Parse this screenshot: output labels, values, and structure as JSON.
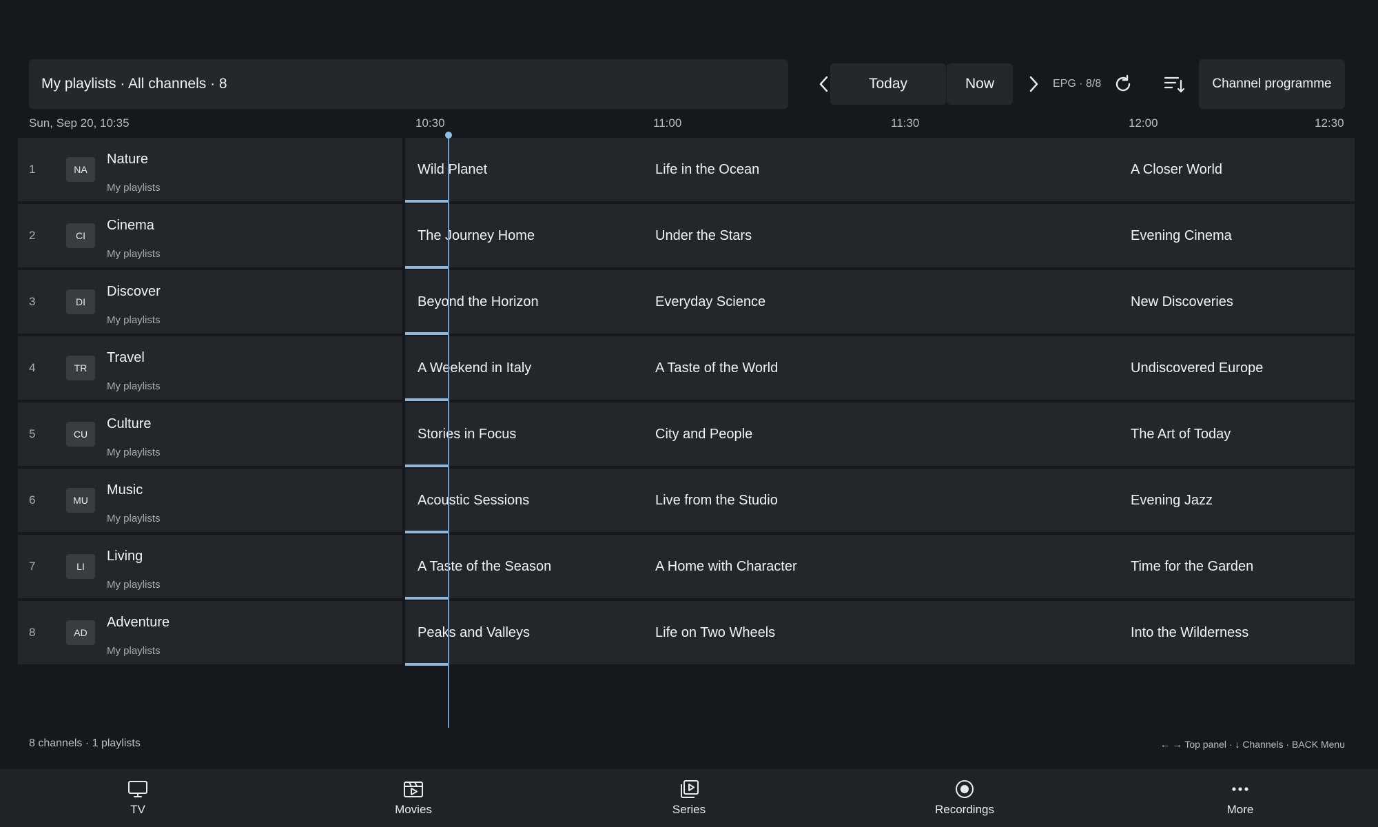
{
  "header": {
    "breadcrumb": "My playlists · All channels · 8",
    "today_label": "Today",
    "now_label": "Now",
    "epg_status": "EPG · 8/8",
    "channel_programme_label": "Channel programme"
  },
  "timeline": {
    "date": "Sun, Sep 20, 10:35",
    "ticks": [
      "10:30",
      "11:00",
      "11:30",
      "12:00",
      "12:30"
    ]
  },
  "channels": [
    {
      "num": "1",
      "logo": "NA",
      "name": "Nature",
      "sub": "My playlists",
      "p1": "Wild Planet",
      "p2": "Life in the Ocean",
      "p3": "A Closer World"
    },
    {
      "num": "2",
      "logo": "CI",
      "name": "Cinema",
      "sub": "My playlists",
      "p1": "The Journey Home",
      "p2": "Under the Stars",
      "p3": "Evening Cinema"
    },
    {
      "num": "3",
      "logo": "DI",
      "name": "Discover",
      "sub": "My playlists",
      "p1": "Beyond the Horizon",
      "p2": "Everyday Science",
      "p3": "New Discoveries"
    },
    {
      "num": "4",
      "logo": "TR",
      "name": "Travel",
      "sub": "My playlists",
      "p1": "A Weekend in Italy",
      "p2": "A Taste of the World",
      "p3": "Undiscovered Europe"
    },
    {
      "num": "5",
      "logo": "CU",
      "name": "Culture",
      "sub": "My playlists",
      "p1": "Stories in Focus",
      "p2": "City and People",
      "p3": "The Art of Today"
    },
    {
      "num": "6",
      "logo": "MU",
      "name": "Music",
      "sub": "My playlists",
      "p1": "Acoustic Sessions",
      "p2": "Live from the Studio",
      "p3": "Evening Jazz"
    },
    {
      "num": "7",
      "logo": "LI",
      "name": "Living",
      "sub": "My playlists",
      "p1": "A Taste of the Season",
      "p2": "A Home with Character",
      "p3": "Time for the Garden"
    },
    {
      "num": "8",
      "logo": "AD",
      "name": "Adventure",
      "sub": "My playlists",
      "p1": "Peaks and Valleys",
      "p2": "Life on Two Wheels",
      "p3": "Into the Wilderness"
    }
  ],
  "footer": {
    "summary": "8 channels · 1 playlists",
    "hints": "← → Top panel · ↓ Channels · BACK Menu"
  },
  "bottom_nav": [
    {
      "label": "TV",
      "icon": "tv-icon"
    },
    {
      "label": "Movies",
      "icon": "movies-icon"
    },
    {
      "label": "Series",
      "icon": "series-icon"
    },
    {
      "label": "Recordings",
      "icon": "recordings-icon"
    },
    {
      "label": "More",
      "icon": "more-icon"
    }
  ],
  "colors": {
    "background": "#15191d",
    "panel": "#23272b",
    "accent": "#6f9ec6"
  }
}
